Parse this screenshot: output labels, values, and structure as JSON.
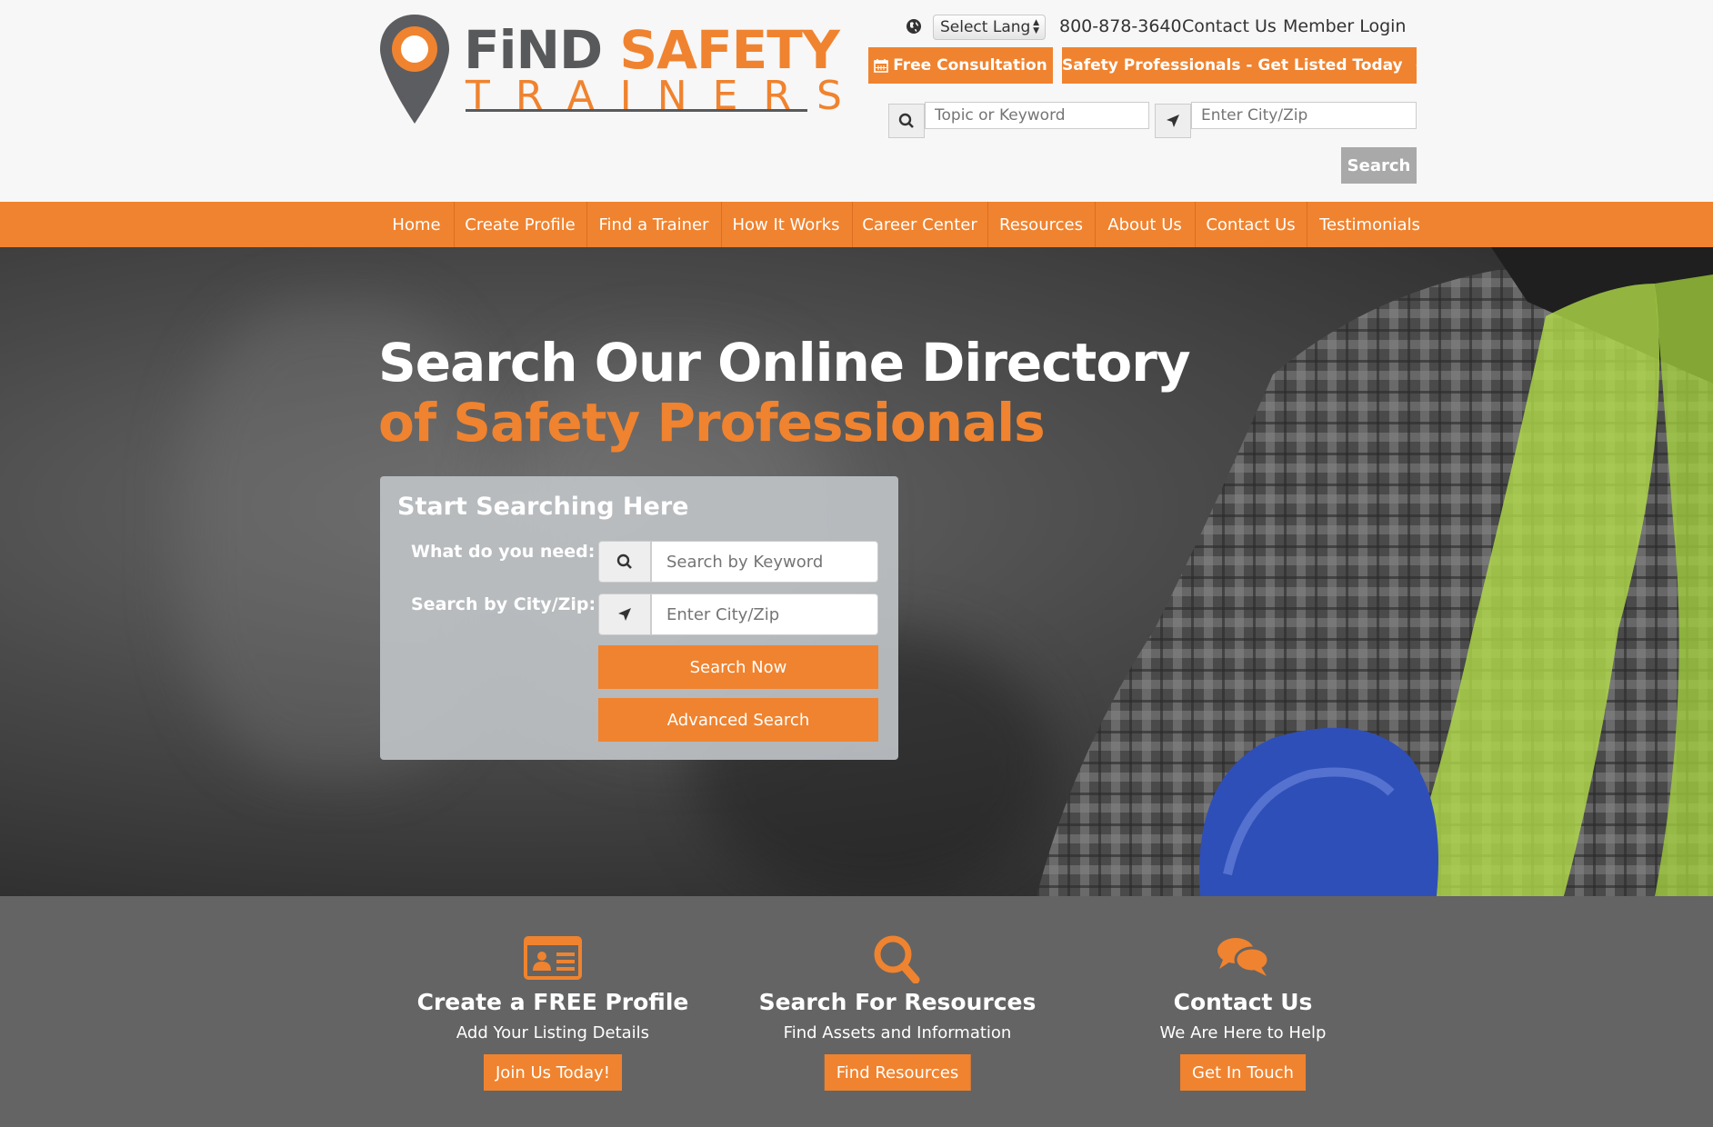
{
  "logo": {
    "word1": "FiND",
    "word2": "SAFETY",
    "word3": "TRAINERS"
  },
  "topbar": {
    "language_select": "Select Lang",
    "phone": "800-878-3640",
    "contact_link": "Contact Us",
    "login_link": "Member Login",
    "free_consultation": "Free Consultation",
    "get_listed": "Safety Professionals - Get Listed Today"
  },
  "header_search": {
    "keyword_placeholder": "Topic or Keyword",
    "city_placeholder": "Enter City/Zip",
    "button": "Search"
  },
  "nav": {
    "items": [
      "Home",
      "Create Profile",
      "Find a Trainer",
      "How It Works",
      "Career Center",
      "Resources",
      "About Us",
      "Contact Us",
      "Testimonials"
    ]
  },
  "hero": {
    "title_line1": "Search Our Online Directory",
    "title_line2": "of Safety Professionals"
  },
  "search_box": {
    "title": "Start Searching Here",
    "label_need": "What do you need:",
    "label_city": "Search by City/Zip:",
    "keyword_placeholder": "Search by Keyword",
    "city_placeholder": "Enter City/Zip",
    "search_now": "Search Now",
    "advanced_search": "Advanced Search"
  },
  "features": [
    {
      "icon": "id-card-icon",
      "title": "Create a FREE Profile",
      "subtitle": "Add Your Listing Details",
      "button": "Join Us Today!"
    },
    {
      "icon": "search-icon",
      "title": "Search For Resources",
      "subtitle": "Find Assets and Information",
      "button": "Find Resources"
    },
    {
      "icon": "chat-bubbles-icon",
      "title": "Contact Us",
      "subtitle": "We Are Here to Help",
      "button": "Get In Touch"
    }
  ],
  "colors": {
    "accent": "#f0832f",
    "dark_grey": "#58595b",
    "band_grey": "#646464"
  }
}
